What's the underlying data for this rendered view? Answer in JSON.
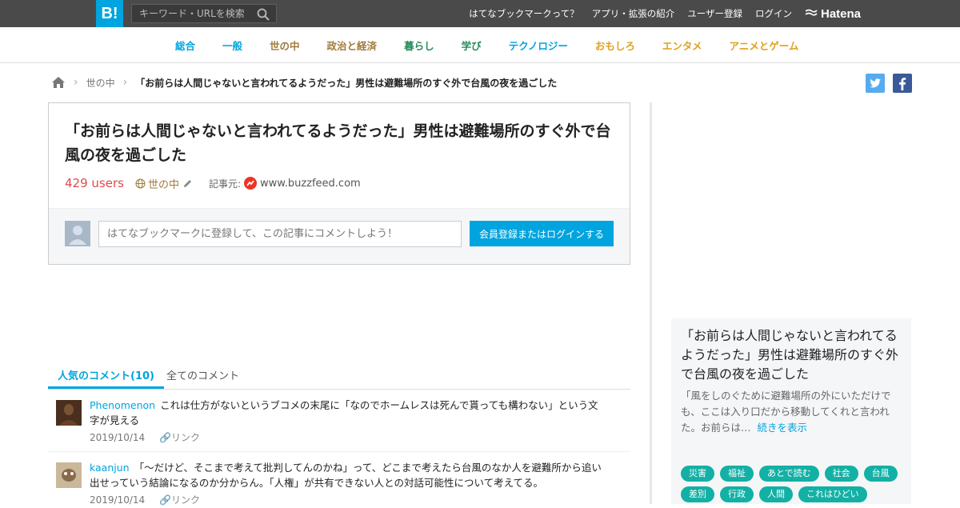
{
  "topbar": {
    "logo": "B!",
    "search_placeholder": "キーワード・URLを検索",
    "nav": [
      "はてなブックマークって？",
      "アプリ・拡張の紹介",
      "ユーザー登録",
      "ログイン"
    ],
    "brand": "Hatena"
  },
  "categories": [
    {
      "label": "総合",
      "color": "#00a4de"
    },
    {
      "label": "一般",
      "color": "#00a4de"
    },
    {
      "label": "世の中",
      "color": "#a07b3d"
    },
    {
      "label": "政治と経済",
      "color": "#a07b3d"
    },
    {
      "label": "暮らし",
      "color": "#2a8a5a"
    },
    {
      "label": "学び",
      "color": "#2a8a5a"
    },
    {
      "label": "テクノロジー",
      "color": "#00a4de"
    },
    {
      "label": "おもしろ",
      "color": "#e0a020"
    },
    {
      "label": "エンタメ",
      "color": "#e0a020"
    },
    {
      "label": "アニメとゲーム",
      "color": "#e0a020"
    }
  ],
  "breadcrumb": {
    "category": "世の中",
    "current": "「お前らは人間じゃないと言われてるようだった」男性は避難場所のすぐ外で台風の夜を過ごした"
  },
  "article": {
    "title": "「お前らは人間じゃないと言われてるようだった」男性は避難場所のすぐ外で台風の夜を過ごした",
    "users": "429 users",
    "category": "世の中",
    "source_label": "記事元:",
    "source": "www.buzzfeed.com",
    "comment_placeholder": "はてなブックマークに登録して、この記事にコメントしよう！",
    "login_button": "会員登録またはログインする"
  },
  "tabs": {
    "popular": "人気のコメント(10)",
    "all": "全てのコメント"
  },
  "comments": [
    {
      "user": "Phenomenon",
      "text": "これは仕方がないというブコメの末尾に「なのでホームレスは死んで貰っても構わない」という文字が見える",
      "date": "2019/10/14",
      "link": "リンク"
    },
    {
      "user": "kaanjun",
      "text": "「～だけど、そこまで考えて批判してんのかね」って、どこまで考えたら台風のなか人を避難所から追い出せっていう結論になるのか分からん。「人権」が共有できない人との対話可能性について考えてる。",
      "date": "2019/10/14",
      "link": "リンク"
    }
  ],
  "sidebar": {
    "title": "「お前らは人間じゃないと言われてるようだった」男性は避難場所のすぐ外で台風の夜を過ごした",
    "description": "「風をしのぐために避難場所の外にいただけでも、ここは入り口だから移動してくれと言われた。お前らは…",
    "more": "続きを表示",
    "tags": [
      "災害",
      "福祉",
      "あとで読む",
      "社会",
      "台風",
      "差別",
      "行政",
      "人間",
      "これはひどい"
    ]
  },
  "colors": {
    "brand": "#00a4de",
    "users": "#e04a4a",
    "tag": "#13b0a5"
  }
}
